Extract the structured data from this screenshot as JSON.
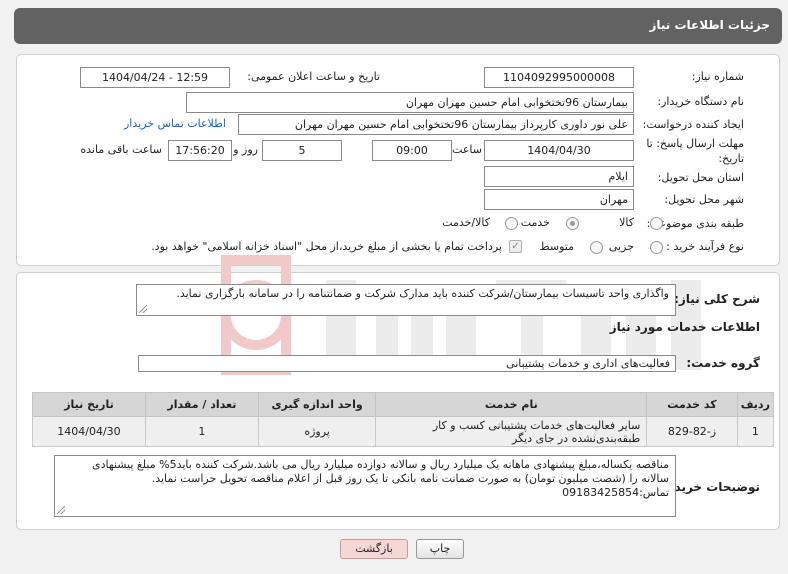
{
  "header": {
    "title": "جزئیات اطلاعات نیاز"
  },
  "form": {
    "need_number_label": "شماره نیاز:",
    "need_number": "1104092995000008",
    "announce_label": "تاریخ و ساعت اعلان عمومی:",
    "announce_value": "1404/04/24 - 12:59",
    "buyer_org_label": "نام دستگاه خریدار:",
    "buyer_org": "بیمارستان 96تختخوابی امام حسین مهران مهران",
    "creator_label": "ایجاد کننده درخواست:",
    "creator": "علی نور داوری کارپرداز بیمارستان 96تختخوابی امام حسین مهران مهران",
    "contact_link": "اطلاعات تماس خریدار",
    "deadline_label": "مهلت ارسال پاسخ: تا تاریخ:",
    "deadline_date": "1404/04/30",
    "time_label": "ساعت",
    "deadline_time": "09:00",
    "days_value": "5",
    "days_label": "روز و",
    "remaining_time": "17:56:20",
    "remaining_label": "ساعت باقی مانده",
    "province_label": "استان محل تحویل:",
    "province": "ایلام",
    "city_label": "شهر محل تحویل:",
    "city": "مهران",
    "category_label": "طبقه بندی موضوعی:",
    "category_options": [
      "کالا",
      "خدمت",
      "کالا/خدمت"
    ],
    "category_selected": "خدمت",
    "process_label": "نوع فرآیند خرید :",
    "process_options": [
      "جزیی",
      "متوسط"
    ],
    "payment_note": "پرداخت تمام یا بخشی از مبلغ خرید،از محل \"اسناد خزانه اسلامی\" خواهد بود."
  },
  "description": {
    "label": "شرح کلی نیاز:",
    "text": "واگذاری واحد تاسیسات بیمارستان/شرکت کننده باید مدارک شرکت و ضمانتنامه را در سامانه بارگزاری نماید."
  },
  "services": {
    "section_title": "اطلاعات خدمات مورد نیاز",
    "group_label": "گروه خدمت:",
    "group_value": "فعالیت‌های اداری و خدمات پشتیبانی",
    "columns": [
      "ردیف",
      "کد خدمت",
      "نام خدمت",
      "واحد اندازه گیری",
      "تعداد / مقدار",
      "تاریخ نیاز"
    ],
    "rows": [
      {
        "row": "1",
        "code": "ز-82-829",
        "name": "سایر فعالیت‌های خدمات پشتیبانی کسب و کار طبقه‌بندی‌نشده در جای دیگر",
        "unit": "پروژه",
        "qty": "1",
        "date": "1404/04/30"
      }
    ]
  },
  "buyer_notes": {
    "label": "توضیحات خریدار:",
    "text": "مناقصه یکساله،مبلغ پیشنهادی ماهانه یک میلیارد ریال و سالانه دوازده میلیارد ریال می باشد.شرکت کننده باید5% مبلغ پیشنهادی سالانه را (شصت میلیون تومان) به صورت ضمانت نامه بانکی تا یک روز قبل از اعلام مناقصه تحویل حراست نماید. تماس:09183425854"
  },
  "buttons": {
    "print": "چاپ",
    "back": "بازگشت"
  },
  "colors": {
    "header_bg": "#626262",
    "link": "#1565c0",
    "back_button_bg": "#f7d6d6"
  }
}
